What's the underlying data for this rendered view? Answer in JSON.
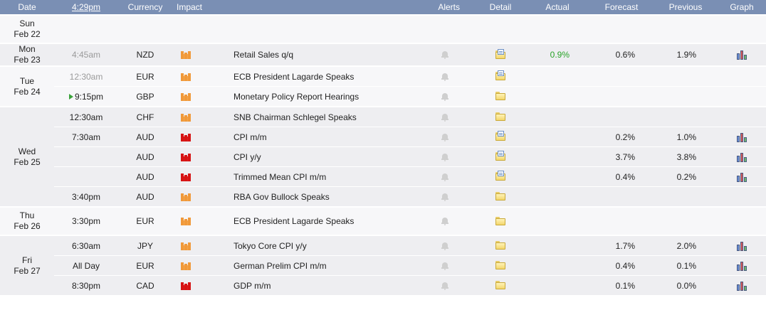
{
  "header": {
    "date": "Date",
    "time": "4:29pm",
    "currency": "Currency",
    "impact": "Impact",
    "alerts": "Alerts",
    "detail": "Detail",
    "actual": "Actual",
    "forecast": "Forecast",
    "previous": "Previous",
    "graph": "Graph"
  },
  "days": [
    {
      "day": "Sun",
      "date": "Feb 22",
      "events": []
    },
    {
      "day": "Mon",
      "date": "Feb 23",
      "events": [
        {
          "time": "4:45am",
          "time_muted": true,
          "currency": "NZD",
          "impact": "medium",
          "event": "Retail Sales q/q",
          "detail": "doc",
          "actual": "0.9%",
          "forecast": "0.6%",
          "previous": "1.9%",
          "graph": true
        }
      ]
    },
    {
      "day": "Tue",
      "date": "Feb 24",
      "events": [
        {
          "time": "12:30am",
          "time_muted": true,
          "currency": "EUR",
          "impact": "medium",
          "event": "ECB President Lagarde Speaks",
          "detail": "doc",
          "actual": "",
          "forecast": "",
          "previous": "",
          "graph": false
        },
        {
          "time": "9:15pm",
          "time_muted": false,
          "upcoming": true,
          "currency": "GBP",
          "impact": "medium",
          "event": "Monetary Policy Report Hearings",
          "detail": "folder",
          "actual": "",
          "forecast": "",
          "previous": "",
          "graph": false
        }
      ]
    },
    {
      "day": "Wed",
      "date": "Feb 25",
      "events": [
        {
          "time": "12:30am",
          "time_muted": false,
          "currency": "CHF",
          "impact": "medium",
          "event": "SNB Chairman Schlegel Speaks",
          "detail": "folder",
          "actual": "",
          "forecast": "",
          "previous": "",
          "graph": false
        },
        {
          "time": "7:30am",
          "time_muted": false,
          "currency": "AUD",
          "impact": "high",
          "event": "CPI m/m",
          "detail": "doc",
          "actual": "",
          "forecast": "0.2%",
          "previous": "1.0%",
          "graph": true
        },
        {
          "time": "",
          "time_muted": false,
          "currency": "AUD",
          "impact": "high",
          "event": "CPI y/y",
          "detail": "doc",
          "actual": "",
          "forecast": "3.7%",
          "previous": "3.8%",
          "graph": true
        },
        {
          "time": "",
          "time_muted": false,
          "currency": "AUD",
          "impact": "high",
          "event": "Trimmed Mean CPI m/m",
          "detail": "doc",
          "actual": "",
          "forecast": "0.4%",
          "previous": "0.2%",
          "graph": true
        },
        {
          "time": "3:40pm",
          "time_muted": false,
          "currency": "AUD",
          "impact": "medium",
          "event": "RBA Gov Bullock Speaks",
          "detail": "folder",
          "actual": "",
          "forecast": "",
          "previous": "",
          "graph": false
        }
      ]
    },
    {
      "day": "Thu",
      "date": "Feb 26",
      "events": [
        {
          "time": "3:30pm",
          "time_muted": false,
          "currency": "EUR",
          "impact": "medium",
          "event": "ECB President Lagarde Speaks",
          "detail": "folder",
          "actual": "",
          "forecast": "",
          "previous": "",
          "graph": false,
          "tall": true
        }
      ]
    },
    {
      "day": "Fri",
      "date": "Feb 27",
      "events": [
        {
          "time": "6:30am",
          "time_muted": false,
          "currency": "JPY",
          "impact": "medium",
          "event": "Tokyo Core CPI y/y",
          "detail": "folder",
          "actual": "",
          "forecast": "1.7%",
          "previous": "2.0%",
          "graph": true
        },
        {
          "time": "All Day",
          "time_muted": false,
          "currency": "EUR",
          "impact": "medium",
          "event": "German Prelim CPI m/m",
          "detail": "folder",
          "actual": "",
          "forecast": "0.4%",
          "previous": "0.1%",
          "graph": true
        },
        {
          "time": "8:30pm",
          "time_muted": false,
          "currency": "CAD",
          "impact": "high",
          "event": "GDP m/m",
          "detail": "folder",
          "actual": "",
          "forecast": "0.1%",
          "previous": "0.0%",
          "graph": true
        }
      ]
    }
  ],
  "colors": {
    "header_bg": "#7a8fb4",
    "actual_better": "#27a327",
    "impact_medium": "#f0993a",
    "impact_high": "#d61414"
  }
}
